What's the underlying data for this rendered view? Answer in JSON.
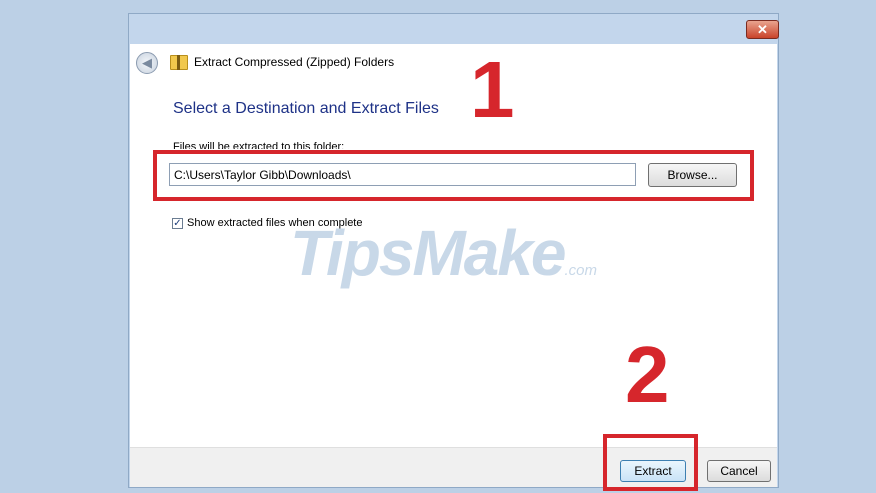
{
  "window": {
    "title": "Extract Compressed (Zipped) Folders",
    "close_glyph": "✕"
  },
  "dialog": {
    "heading": "Select a Destination and Extract Files",
    "folder_label": "Files will be extracted to this folder:",
    "path_value": "C:\\Users\\Taylor Gibb\\Downloads\\",
    "browse_label": "Browse...",
    "show_files_label": "Show extracted files when complete",
    "show_files_checked": true,
    "check_glyph": "✓"
  },
  "footer": {
    "extract_label": "Extract",
    "cancel_label": "Cancel"
  },
  "annotations": {
    "step1": "1",
    "step2": "2",
    "highlight_color": "#d6262c"
  },
  "watermark": {
    "main": "TipsMake",
    "suffix": ".com"
  },
  "icons": {
    "back": "back-arrow-icon",
    "folder": "zip-folder-icon",
    "close": "close-icon"
  }
}
